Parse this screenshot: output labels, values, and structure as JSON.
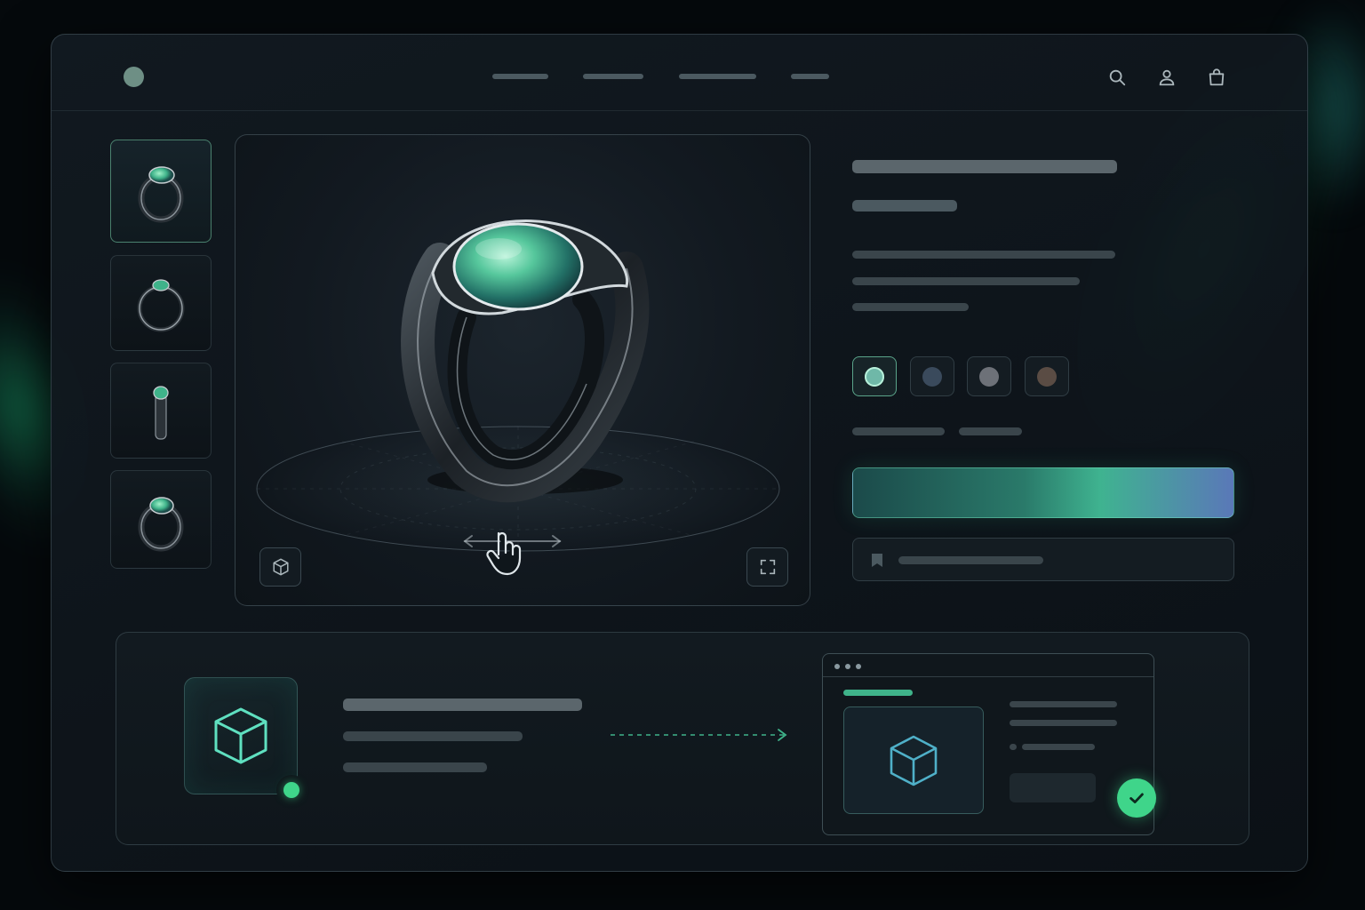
{
  "app": {
    "title": "",
    "accent_color": "#3fd58a",
    "brand_color": "#6e8f85"
  },
  "navbar": {
    "logo": "logo-dot",
    "links": [
      "",
      "",
      "",
      ""
    ],
    "icons": [
      "search-icon",
      "user-icon",
      "bag-icon"
    ]
  },
  "gallery": {
    "thumbnails": [
      {
        "view": "ring-angle-view",
        "active": true
      },
      {
        "view": "ring-front-view",
        "active": false
      },
      {
        "view": "ring-side-view",
        "active": false
      },
      {
        "view": "ring-angle-view-alt",
        "active": false
      }
    ]
  },
  "viewer": {
    "icons": [
      "cube-icon",
      "drag-hand-icon",
      "fullscreen-icon"
    ],
    "stone_color": "#3fb38a",
    "band_color": "#1c2126"
  },
  "product": {
    "title": "",
    "price": "",
    "description_lines": [
      "",
      "",
      ""
    ],
    "swatch_colors": [
      "#6fb8a8",
      "#3a4a5c",
      "#6d7178",
      "#5a4c44"
    ],
    "selected_swatch": 0,
    "cta_label": "",
    "wishlist_label": "",
    "wishlist_icon": "bookmark-icon"
  },
  "upload_panel": {
    "model_icon": "cube-icon",
    "status": "online",
    "status_color": "#3fd58a",
    "text_lines": [
      "",
      "",
      ""
    ],
    "arrow_icon": "arrow-right-icon",
    "preview": {
      "icon": "cube-icon",
      "done_icon": "check-icon"
    }
  }
}
